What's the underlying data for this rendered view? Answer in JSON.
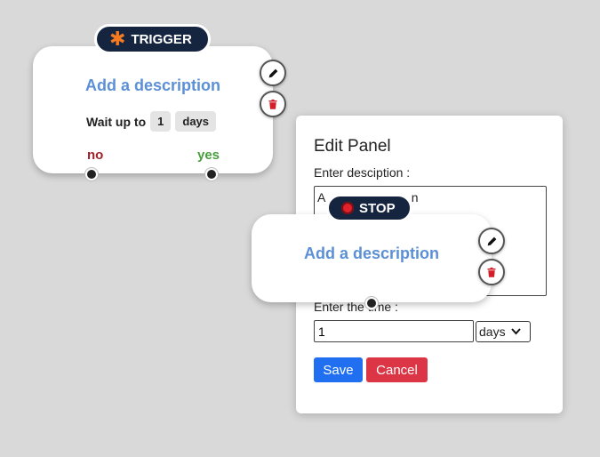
{
  "trigger_node": {
    "badge": "TRIGGER",
    "description": "Add a description",
    "wait_prefix": "Wait up to",
    "wait_value": "1",
    "wait_unit": "days",
    "outlet_no": "no",
    "outlet_yes": "yes"
  },
  "stop_node": {
    "badge": "STOP",
    "description": "Add a description"
  },
  "edit_panel": {
    "title": "Edit Panel",
    "description_label": "Enter desciption :",
    "description_value": "A                         n",
    "time_label": "Enter the time :",
    "time_value": "1",
    "unit_selected": "days",
    "save_label": "Save",
    "cancel_label": "Cancel"
  },
  "icons": {
    "edit": "pencil-icon",
    "delete": "trash-icon",
    "trigger": "asterisk-icon",
    "stop": "stop-dot-icon"
  },
  "colors": {
    "background": "#d9d9d9",
    "badge": "#16253f",
    "description": "#5b8fd6",
    "no": "#a02228",
    "yes": "#479e3c",
    "save": "#1f6ff0",
    "cancel": "#dc3545"
  }
}
